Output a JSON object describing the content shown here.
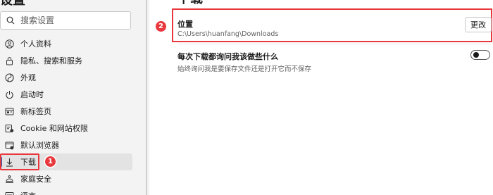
{
  "sidebar": {
    "title": "设置",
    "search": {
      "placeholder": "搜索设置",
      "value": ""
    },
    "items": [
      {
        "label": "个人资料",
        "icon": "profile-icon"
      },
      {
        "label": "隐私、搜索和服务",
        "icon": "lock-icon"
      },
      {
        "label": "外观",
        "icon": "appearance-icon"
      },
      {
        "label": "启动时",
        "icon": "power-icon"
      },
      {
        "label": "新标签页",
        "icon": "new-tab-icon"
      },
      {
        "label": "Cookie 和网站权限",
        "icon": "site-permissions-icon"
      },
      {
        "label": "默认浏览器",
        "icon": "default-browser-icon"
      },
      {
        "label": "下载",
        "icon": "download-icon",
        "active": true
      },
      {
        "label": "家庭安全",
        "icon": "family-icon"
      },
      {
        "label": "语言",
        "icon": "language-icon"
      }
    ]
  },
  "main": {
    "title": "下载",
    "location": {
      "title": "位置",
      "path": "C:\\Users\\huanfang\\Downloads",
      "button_label": "更改"
    },
    "ask": {
      "title": "每次下载都询问我该做些什么",
      "description": "始终询问我是要保存文件还是打开它而不保存",
      "enabled": false
    }
  },
  "annotations": {
    "badge_1": "1",
    "badge_2": "2"
  },
  "colors": {
    "highlight": "#e8383d",
    "accent": "#0f6cbd",
    "sidebar_bg": "#f3f3f3",
    "main_bg": "#ffffff"
  }
}
